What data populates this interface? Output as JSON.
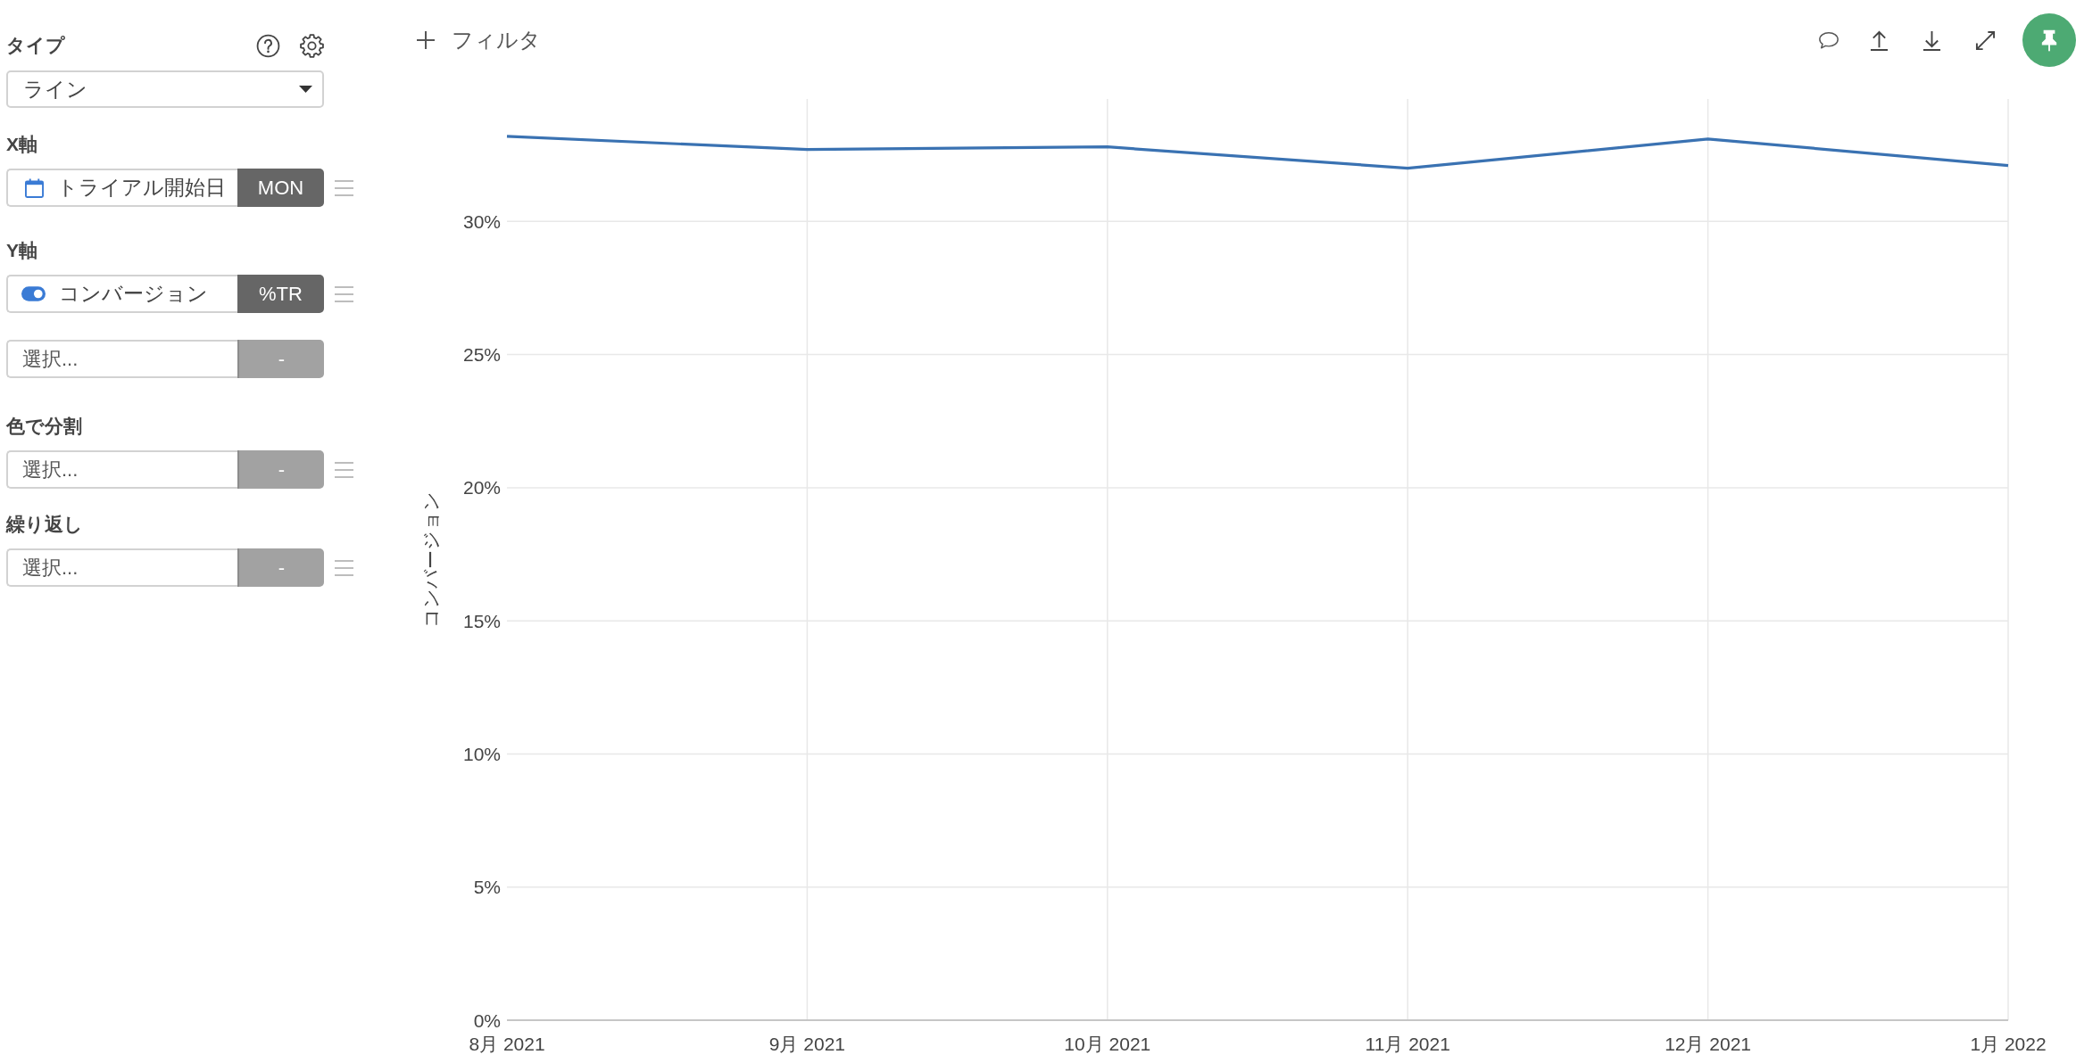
{
  "sidebar": {
    "type": {
      "label": "タイプ",
      "select": {
        "value": "ライン"
      }
    },
    "sections": [
      {
        "label": "X軸",
        "fields": [
          {
            "kind": "calendar",
            "value": "トライアル開始日",
            "aggregation": {
              "label": "MON",
              "disabled": false
            },
            "handle": true
          }
        ]
      },
      {
        "label": "Y軸",
        "fields": [
          {
            "kind": "toggle",
            "value": "コンバージョン",
            "aggregation": {
              "label": "%TR",
              "disabled": false
            },
            "handle": true
          },
          {
            "kind": "empty",
            "placeholder": "選択...",
            "aggregation": {
              "label": "-",
              "disabled": true
            },
            "handle": false
          }
        ]
      },
      {
        "label": "色で分割",
        "fields": [
          {
            "kind": "empty",
            "placeholder": "選択...",
            "aggregation": {
              "label": "-",
              "disabled": true
            },
            "handle": true
          }
        ]
      },
      {
        "label": "繰り返し",
        "fields": [
          {
            "kind": "empty",
            "placeholder": "選択...",
            "aggregation": {
              "label": "-",
              "disabled": true
            },
            "handle": true
          }
        ]
      }
    ]
  },
  "toolbar": {
    "filter_button": {
      "label": "フィルタ"
    }
  },
  "chart": {
    "chart_data": {
      "type": "line",
      "ylabel": "コンバージョン",
      "categories": [
        "8月 2021",
        "9月 2021",
        "10月 2021",
        "11月 2021",
        "12月 2021",
        "1月 2022"
      ],
      "series": [
        {
          "color": "#3a72b2",
          "values": [
            33.2,
            32.7,
            32.8,
            32.0,
            33.1,
            32.1
          ]
        }
      ],
      "ylim": [
        0,
        34.6
      ],
      "yticks": [
        {
          "value": 0,
          "label": "0%"
        },
        {
          "value": 5,
          "label": "5%"
        },
        {
          "value": 10,
          "label": "10%"
        },
        {
          "value": 15,
          "label": "15%"
        },
        {
          "value": 20,
          "label": "20%"
        },
        {
          "value": 25,
          "label": "25%"
        },
        {
          "value": 30,
          "label": "30%"
        }
      ],
      "grid": true
    }
  }
}
